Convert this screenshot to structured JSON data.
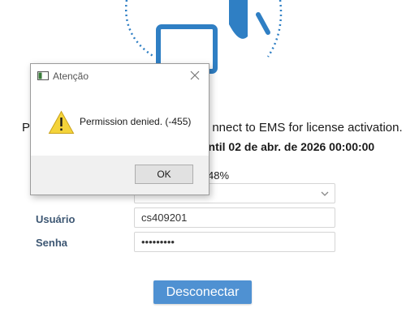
{
  "page": {
    "line1": "Pl                              nnect to EMS for license activation.",
    "line1_visible_left": "Pl",
    "line1_visible_right": "nnect to EMS for license activation.",
    "line2_visible": "until 02 de abr. de 2026 00:00:00",
    "progress_visible": "48%"
  },
  "form": {
    "rows": [
      {
        "label": "",
        "value": ""
      },
      {
        "label": "Usuário",
        "value": "cs409201"
      },
      {
        "label": "Senha",
        "value": "•••••••••"
      }
    ],
    "disconnect_label": "Desconectar"
  },
  "dialog": {
    "title": "Atenção",
    "message": "Permission denied. (-455)",
    "ok_label": "OK",
    "icons": {
      "app": "window-icon",
      "close": "close-icon",
      "warning": "warning-icon"
    }
  },
  "colors": {
    "accent": "#4f91d2",
    "illustration": "#2f7fc4",
    "label": "#3d5773",
    "warning": "#f4d33a"
  }
}
